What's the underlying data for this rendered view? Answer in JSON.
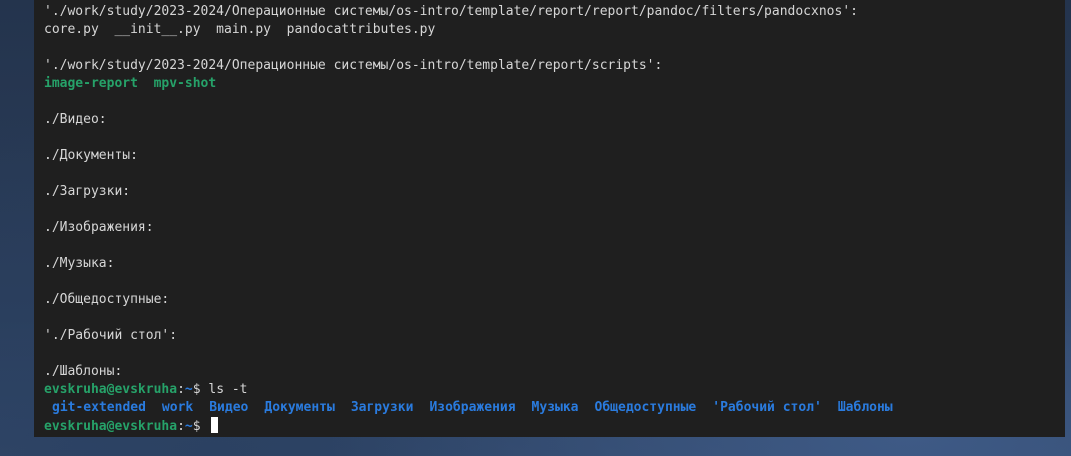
{
  "terminal": {
    "lines": [
      {
        "kind": "text",
        "text": "'./work/study/2023-2024/Операционные системы/os-intro/template/report/report/pandoc/filters/pandocxnos':"
      },
      {
        "kind": "text",
        "text": "core.py  __init__.py  main.py  pandocattributes.py"
      },
      {
        "kind": "blank",
        "text": ""
      },
      {
        "kind": "text",
        "text": "'./work/study/2023-2024/Операционные системы/os-intro/template/report/scripts':"
      },
      {
        "kind": "exec",
        "items": [
          "image-report",
          "mpv-shot"
        ]
      },
      {
        "kind": "blank",
        "text": ""
      },
      {
        "kind": "text",
        "text": "./Видео:"
      },
      {
        "kind": "blank",
        "text": ""
      },
      {
        "kind": "text",
        "text": "./Документы:"
      },
      {
        "kind": "blank",
        "text": ""
      },
      {
        "kind": "text",
        "text": "./Загрузки:"
      },
      {
        "kind": "blank",
        "text": ""
      },
      {
        "kind": "text",
        "text": "./Изображения:"
      },
      {
        "kind": "blank",
        "text": ""
      },
      {
        "kind": "text",
        "text": "./Музыка:"
      },
      {
        "kind": "blank",
        "text": ""
      },
      {
        "kind": "text",
        "text": "./Общедоступные:"
      },
      {
        "kind": "blank",
        "text": ""
      },
      {
        "kind": "text",
        "text": "'./Рабочий стол':"
      },
      {
        "kind": "blank",
        "text": ""
      },
      {
        "kind": "text",
        "text": "./Шаблоны:"
      }
    ],
    "prompt": {
      "user_host": "evskruha@evskruha",
      "separator": ":",
      "path": "~",
      "symbol": "$ "
    },
    "command": "ls -t",
    "ls_output": [
      "git-extended",
      "work",
      "Видео",
      "Документы",
      "Загрузки",
      "Изображения",
      "Музыка",
      "Общедоступные",
      "'Рабочий стол'",
      "Шаблоны"
    ],
    "colors": {
      "background": "#1f1f1f",
      "text": "#d6d6d6",
      "green": "#26a269",
      "blue": "#2a7bde"
    }
  }
}
